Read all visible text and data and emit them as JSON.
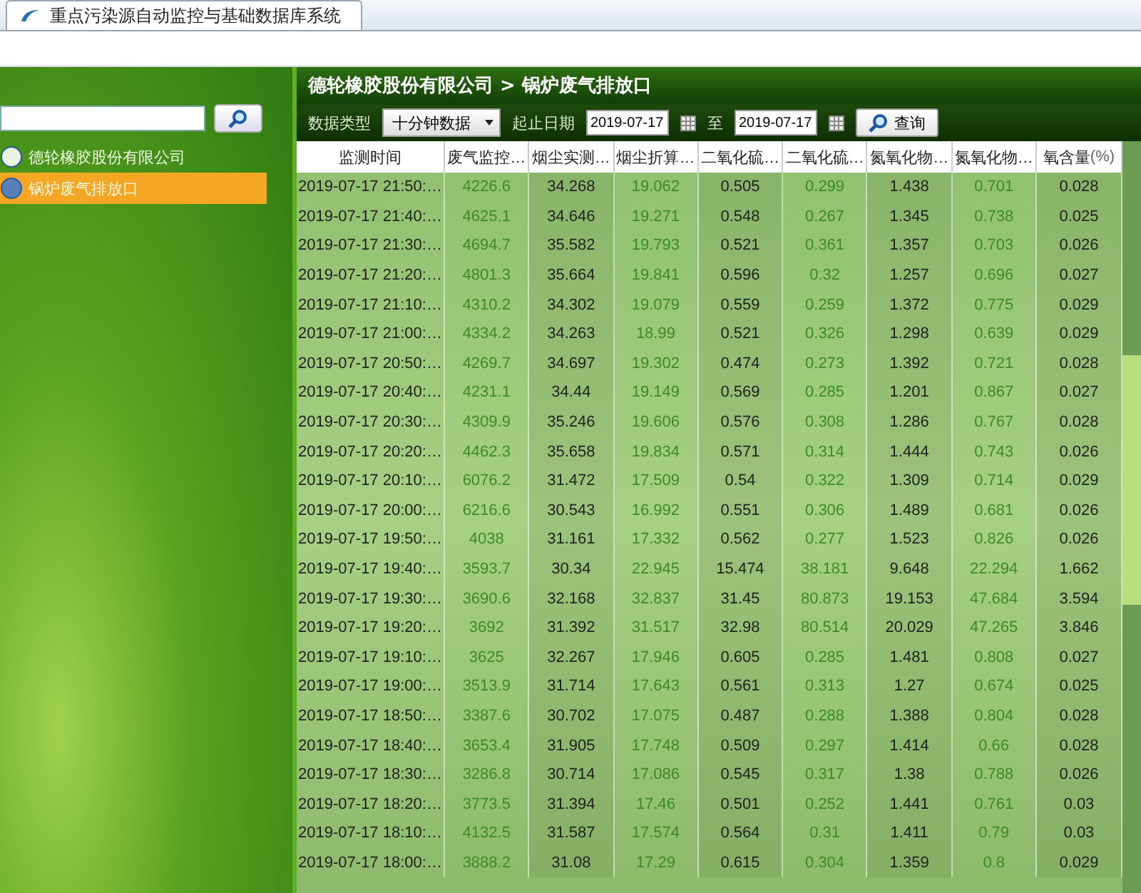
{
  "browser_tab": {
    "title": "重点污染源自动监控与基础数据库系统",
    "selected": true
  },
  "sidebar": {
    "tree": [
      {
        "label": "德轮橡胶股份有限公司",
        "selected": false,
        "children": [
          {
            "label": "锅炉废气排放口",
            "selected": true
          }
        ]
      }
    ]
  },
  "panel": {
    "title": "德轮橡胶股份有限公司 > 锅炉废气排放口",
    "toolbar": {
      "type_label": "数据类型",
      "type_value": "十分钟数据",
      "date_label": "起止日期",
      "date_from": "2019-07-17",
      "date_sep": "至",
      "date_to": "2019-07-17",
      "query_button": "查询"
    },
    "table": {
      "columns": [
        {
          "label": "监测时间",
          "kind": "time"
        },
        {
          "label": "废气监控…",
          "kind": "tinted"
        },
        {
          "label": "烟尘实测…",
          "kind": "plain"
        },
        {
          "label": "烟尘折算…",
          "kind": "tinted"
        },
        {
          "label": "二氧化硫…",
          "kind": "plain"
        },
        {
          "label": "二氧化硫…",
          "kind": "tinted"
        },
        {
          "label": "氮氧化物…",
          "kind": "plain"
        },
        {
          "label": "氮氧化物…",
          "kind": "tinted"
        },
        {
          "label": "氧含量",
          "unit": "(%)",
          "kind": "plain"
        }
      ],
      "rows": [
        [
          "2019-07-17 21:50:…",
          "4226.6",
          "34.268",
          "19.062",
          "0.505",
          "0.299",
          "1.438",
          "0.701",
          "0.028"
        ],
        [
          "2019-07-17 21:40:…",
          "4625.1",
          "34.646",
          "19.271",
          "0.548",
          "0.267",
          "1.345",
          "0.738",
          "0.025"
        ],
        [
          "2019-07-17 21:30:…",
          "4694.7",
          "35.582",
          "19.793",
          "0.521",
          "0.361",
          "1.357",
          "0.703",
          "0.026"
        ],
        [
          "2019-07-17 21:20:…",
          "4801.3",
          "35.664",
          "19.841",
          "0.596",
          "0.32",
          "1.257",
          "0.696",
          "0.027"
        ],
        [
          "2019-07-17 21:10:…",
          "4310.2",
          "34.302",
          "19.079",
          "0.559",
          "0.259",
          "1.372",
          "0.775",
          "0.029"
        ],
        [
          "2019-07-17 21:00:…",
          "4334.2",
          "34.263",
          "18.99",
          "0.521",
          "0.326",
          "1.298",
          "0.639",
          "0.029"
        ],
        [
          "2019-07-17 20:50:…",
          "4269.7",
          "34.697",
          "19.302",
          "0.474",
          "0.273",
          "1.392",
          "0.721",
          "0.028"
        ],
        [
          "2019-07-17 20:40:…",
          "4231.1",
          "34.44",
          "19.149",
          "0.569",
          "0.285",
          "1.201",
          "0.867",
          "0.027"
        ],
        [
          "2019-07-17 20:30:…",
          "4309.9",
          "35.246",
          "19.606",
          "0.576",
          "0.308",
          "1.286",
          "0.767",
          "0.028"
        ],
        [
          "2019-07-17 20:20:…",
          "4462.3",
          "35.658",
          "19.834",
          "0.571",
          "0.314",
          "1.444",
          "0.743",
          "0.026"
        ],
        [
          "2019-07-17 20:10:…",
          "6076.2",
          "31.472",
          "17.509",
          "0.54",
          "0.322",
          "1.309",
          "0.714",
          "0.029"
        ],
        [
          "2019-07-17 20:00:…",
          "6216.6",
          "30.543",
          "16.992",
          "0.551",
          "0.306",
          "1.489",
          "0.681",
          "0.026"
        ],
        [
          "2019-07-17 19:50:…",
          "4038",
          "31.161",
          "17.332",
          "0.562",
          "0.277",
          "1.523",
          "0.826",
          "0.026"
        ],
        [
          "2019-07-17 19:40:…",
          "3593.7",
          "30.34",
          "22.945",
          "15.474",
          "38.181",
          "9.648",
          "22.294",
          "1.662"
        ],
        [
          "2019-07-17 19:30:…",
          "3690.6",
          "32.168",
          "32.837",
          "31.45",
          "80.873",
          "19.153",
          "47.684",
          "3.594"
        ],
        [
          "2019-07-17 19:20:…",
          "3692",
          "31.392",
          "31.517",
          "32.98",
          "80.514",
          "20.029",
          "47.265",
          "3.846"
        ],
        [
          "2019-07-17 19:10:…",
          "3625",
          "32.267",
          "17.946",
          "0.605",
          "0.285",
          "1.481",
          "0.808",
          "0.027"
        ],
        [
          "2019-07-17 19:00:…",
          "3513.9",
          "31.714",
          "17.643",
          "0.561",
          "0.313",
          "1.27",
          "0.674",
          "0.025"
        ],
        [
          "2019-07-17 18:50:…",
          "3387.6",
          "30.702",
          "17.075",
          "0.487",
          "0.288",
          "1.388",
          "0.804",
          "0.028"
        ],
        [
          "2019-07-17 18:40:…",
          "3653.4",
          "31.905",
          "17.748",
          "0.509",
          "0.297",
          "1.414",
          "0.66",
          "0.028"
        ],
        [
          "2019-07-17 18:30:…",
          "3286.8",
          "30.714",
          "17.086",
          "0.545",
          "0.317",
          "1.38",
          "0.788",
          "0.026"
        ],
        [
          "2019-07-17 18:20:…",
          "3773.5",
          "31.394",
          "17.46",
          "0.501",
          "0.252",
          "1.441",
          "0.761",
          "0.03"
        ],
        [
          "2019-07-17 18:10:…",
          "4132.5",
          "31.587",
          "17.574",
          "0.564",
          "0.31",
          "1.411",
          "0.79",
          "0.03"
        ],
        [
          "2019-07-17 18:00:…",
          "3888.2",
          "31.08",
          "17.29",
          "0.615",
          "0.304",
          "1.359",
          "0.8",
          "0.029"
        ]
      ]
    }
  }
}
